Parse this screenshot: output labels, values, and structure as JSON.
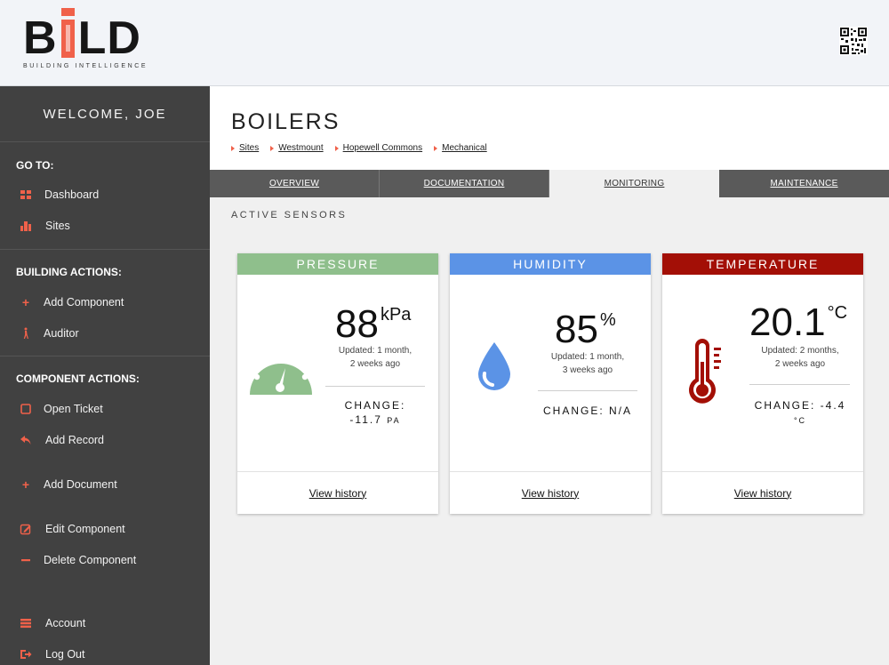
{
  "brand": {
    "logo_left": "B",
    "logo_right": "LD",
    "tagline": "BUILDING INTELLIGENCE",
    "accent_color": "#f0614a"
  },
  "header": {
    "qr_icon": "qr-code-icon"
  },
  "sidebar": {
    "welcome": "WELCOME, JOE",
    "goto_title": "GO TO:",
    "goto_items": [
      {
        "label": "Dashboard",
        "icon": "grid-icon"
      },
      {
        "label": "Sites",
        "icon": "buildings-icon"
      }
    ],
    "building_title": "BUILDING ACTIONS:",
    "building_items": [
      {
        "label": "Add Component",
        "icon": "plus-icon"
      },
      {
        "label": "Auditor",
        "icon": "walking-person-icon"
      }
    ],
    "component_title": "COMPONENT ACTIONS:",
    "component_items": [
      {
        "label": "Open Ticket",
        "icon": "square-icon"
      },
      {
        "label": "Add Record",
        "icon": "reply-arrow-icon"
      },
      {
        "label": "Add Document",
        "icon": "plus-icon"
      },
      {
        "label": "Edit Component",
        "icon": "edit-icon"
      },
      {
        "label": "Delete Component",
        "icon": "minus-icon"
      }
    ],
    "bottom_items": [
      {
        "label": "Account",
        "icon": "list-icon"
      },
      {
        "label": "Log Out",
        "icon": "logout-icon"
      }
    ]
  },
  "page": {
    "title": "BOILERS",
    "breadcrumb": [
      "Sites",
      "Westmount",
      "Hopewell Commons",
      "Mechanical"
    ],
    "tabs": [
      {
        "label": "OVERVIEW",
        "active": false
      },
      {
        "label": "DOCUMENTATION",
        "active": false
      },
      {
        "label": "MONITORING",
        "active": true
      },
      {
        "label": "MAINTENANCE",
        "active": false
      }
    ],
    "section_label": "ACTIVE SENSORS"
  },
  "sensors": [
    {
      "title": "PRESSURE",
      "color": "#8fbf8c",
      "icon": "gauge-icon",
      "value": "88",
      "unit": "kPa",
      "updated_line1": "Updated: 1 month,",
      "updated_line2": "2 weeks ago",
      "change_line1": "CHANGE:",
      "change_line2": "-11.7",
      "change_unit": "PA",
      "link": "View history"
    },
    {
      "title": "HUMIDITY",
      "color": "#5b93e6",
      "icon": "water-drop-icon",
      "value": "85",
      "unit": "%",
      "updated_line1": "Updated: 1 month,",
      "updated_line2": "3 weeks ago",
      "change_line1": "CHANGE: N/A",
      "link": "View history"
    },
    {
      "title": "TEMPERATURE",
      "color": "#a30f06",
      "icon": "thermometer-icon",
      "value": "20.1",
      "unit": "°C",
      "updated_line1": "Updated: 2 months,",
      "updated_line2": "2 weeks ago",
      "change_line1": "CHANGE: -4.4",
      "change_unit": "°C",
      "link": "View history"
    }
  ]
}
